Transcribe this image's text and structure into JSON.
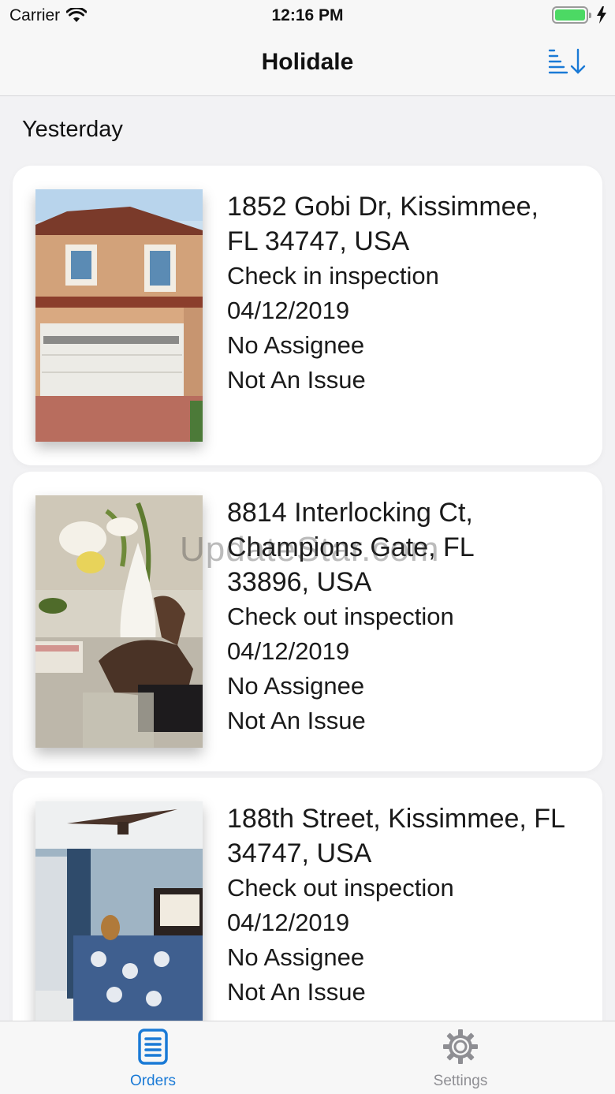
{
  "status_bar": {
    "carrier": "Carrier",
    "time": "12:16 PM"
  },
  "nav": {
    "title": "Holidale",
    "sort_icon": "sort-descending-icon"
  },
  "section": {
    "title": "Yesterday"
  },
  "orders": [
    {
      "address_line1": "1852 Gobi Dr, Kissimmee,",
      "address_line2": "FL 34747, USA",
      "address_line3": "",
      "inspection": "Check in inspection",
      "date": "04/12/2019",
      "assignee": "No Assignee",
      "issue": "Not An Issue"
    },
    {
      "address_line1": "8814 Interlocking Ct,",
      "address_line2": "Champions Gate, FL",
      "address_line3": "33896, USA",
      "inspection": "Check out inspection",
      "date": "04/12/2019",
      "assignee": "No Assignee",
      "issue": "Not An Issue"
    },
    {
      "address_line1": "188th Street, Kissimmee, FL",
      "address_line2": "34747, USA",
      "address_line3": "",
      "inspection": "Check out inspection",
      "date": "04/12/2019",
      "assignee": "No Assignee",
      "issue": "Not An Issue"
    }
  ],
  "watermark": "UpdateStar.com",
  "tabs": {
    "orders": "Orders",
    "settings": "Settings"
  },
  "colors": {
    "accent": "#1a7ad6",
    "battery": "#4cd964",
    "inactive": "#8e8e93"
  }
}
